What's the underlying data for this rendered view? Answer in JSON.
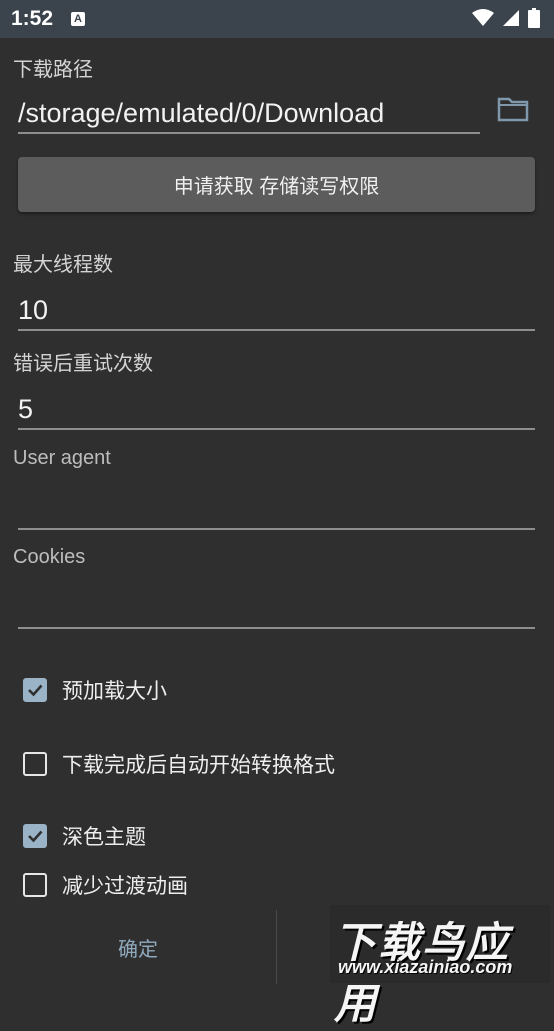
{
  "status_bar": {
    "time": "1:52",
    "notification_icon": "A"
  },
  "download_path": {
    "label": "下载路径",
    "value": "/storage/emulated/0/Download",
    "browse_icon": "folder-icon"
  },
  "permission_button": {
    "label": "申请获取 存储读写权限"
  },
  "max_threads": {
    "label": "最大线程数",
    "value": "10"
  },
  "retry_count": {
    "label": "错误后重试次数",
    "value": "5"
  },
  "user_agent": {
    "label": "User agent",
    "value": ""
  },
  "cookies": {
    "label": "Cookies",
    "value": ""
  },
  "options": [
    {
      "label": "预加载大小",
      "checked": true
    },
    {
      "label": "下载完成后自动开始转换格式",
      "checked": false
    },
    {
      "label": "深色主题",
      "checked": true
    },
    {
      "label": "减少过渡动画",
      "checked": false
    }
  ],
  "footer": {
    "confirm_label": "确定"
  },
  "watermark": {
    "title": "下载鸟应用",
    "url": "www.xiazainiao.com"
  },
  "colors": {
    "background": "#2f2f2f",
    "status_bar": "#3b434d",
    "accent": "#9bb3c6"
  }
}
